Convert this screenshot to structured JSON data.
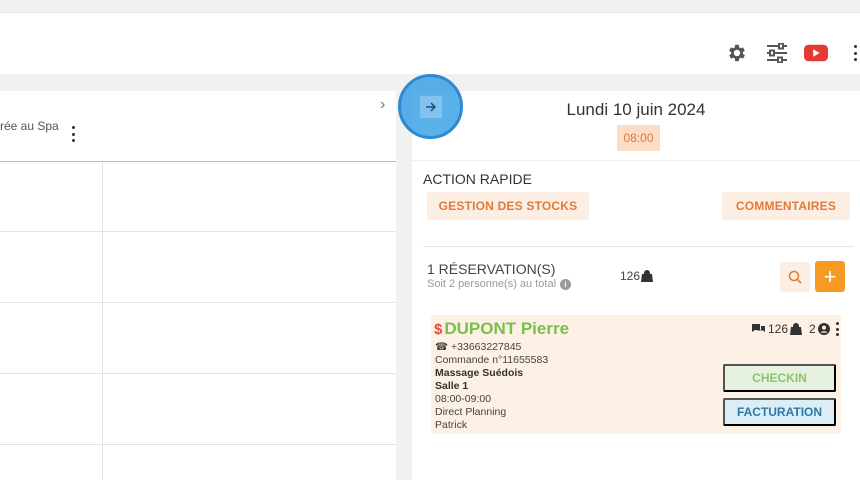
{
  "toolbar": {
    "icons": [
      "gear-icon",
      "sliders-icon",
      "youtube-icon",
      "kebab-menu-icon"
    ],
    "youtube_color": "#e53935"
  },
  "left_panel": {
    "column_title": "rée au Spa"
  },
  "right_panel": {
    "date": "Lundi 10 juin 2024",
    "time": "08:00",
    "action_title": "ACTION RAPIDE",
    "gestion_label": "GESTION DES STOCKS",
    "commentaires_label": "COMMENTAIRES",
    "reservation_count": "1 RÉSERVATION(S)",
    "reservation_sub": "Soit 2 personne(s) au total",
    "reservation_num": "126",
    "plus_label": "+"
  },
  "card": {
    "currency": "$",
    "name": "DUPONT Pierre",
    "phone": "+33663227845",
    "order": "Commande n°11655583",
    "service": "Massage Suédois",
    "room": "Salle 1",
    "hours": "08:00-09:00",
    "source": "Direct Planning",
    "staff": "Patrick",
    "comments_num": "126",
    "persons_num": "2",
    "checkin_label": "CHECKIN",
    "facturation_label": "FACTURATION"
  },
  "colors": {
    "accent_orange": "#f59a23",
    "chip_text": "#e07b39",
    "name_green": "#7bbf4b",
    "checkin_green": "#8cc56b",
    "facturation_blue": "#2a7aa8"
  }
}
